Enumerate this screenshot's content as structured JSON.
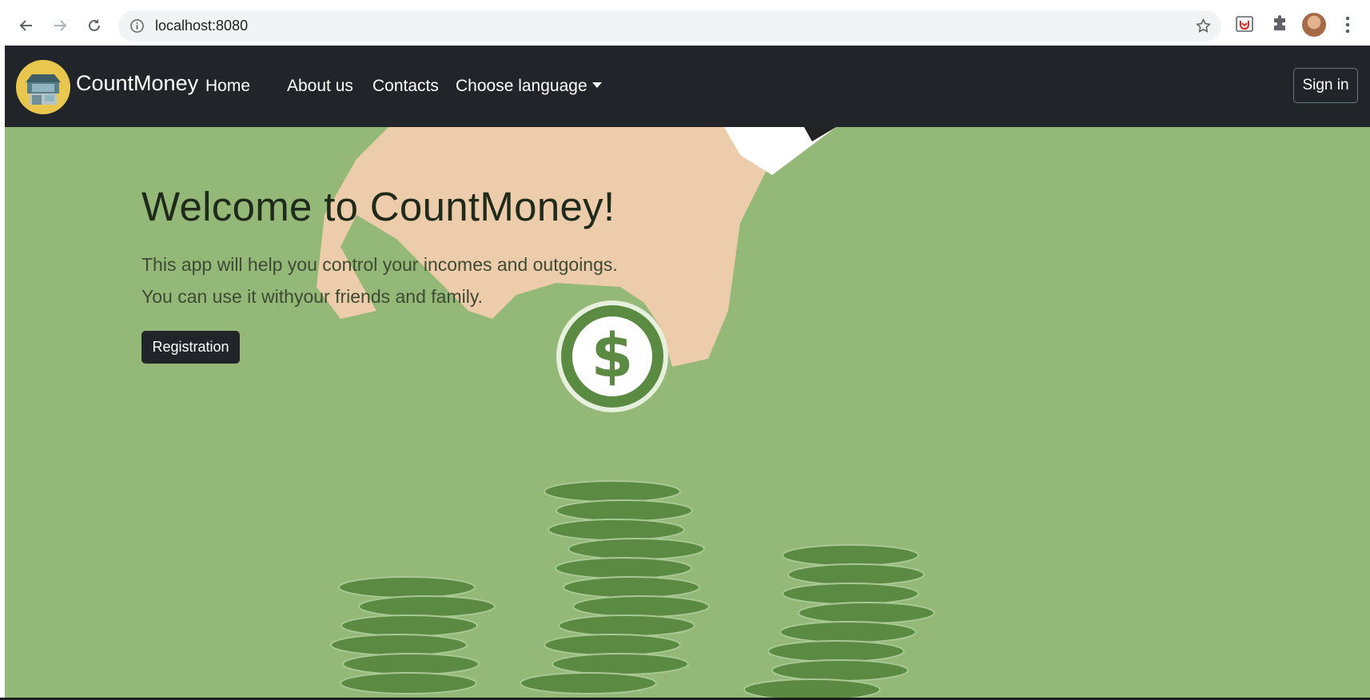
{
  "browser": {
    "url": "localhost:8080",
    "icons": [
      "back-arrow-icon",
      "forward-arrow-icon",
      "reload-icon",
      "info-icon",
      "bookmark-star-icon",
      "extension-icon",
      "puzzle-icon",
      "profile-avatar",
      "menu-dots-icon"
    ]
  },
  "navbar": {
    "brand": "CountMoney",
    "links": [
      "Home",
      "About us",
      "Contacts",
      "Choose language"
    ],
    "signin": "Sign in"
  },
  "hero": {
    "title": "Welcome to CountMoney!",
    "line1": "This app will help you control your incomes and outgoings.",
    "line2": "You can use it withyour friends and family.",
    "button": "Registration"
  },
  "colors": {
    "navbar": "#212529",
    "hero_bg": "#93b877",
    "coin": "#5b8a42",
    "logo": "#e9c74f"
  }
}
